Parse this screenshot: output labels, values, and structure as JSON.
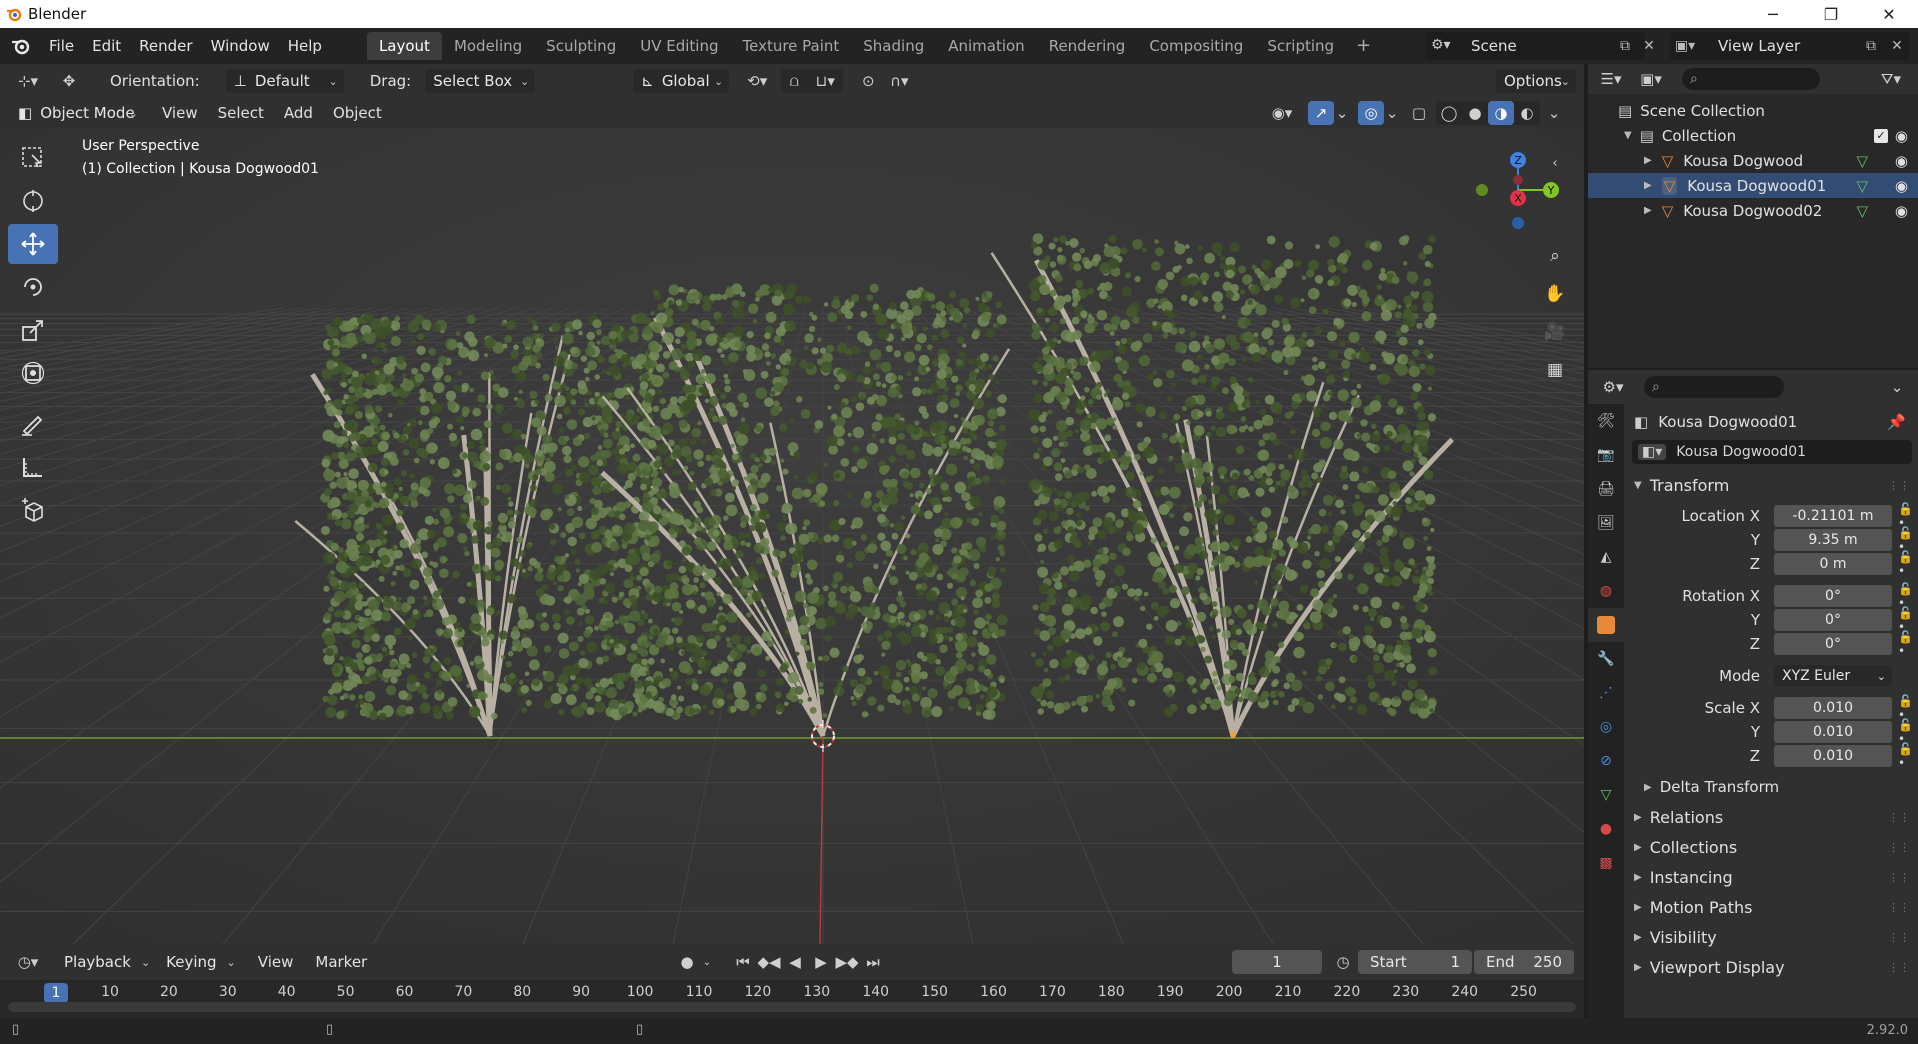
{
  "window": {
    "title": "Blender"
  },
  "menu": [
    "File",
    "Edit",
    "Render",
    "Window",
    "Help"
  ],
  "workspaces": {
    "tabs": [
      "Layout",
      "Modeling",
      "Sculpting",
      "UV Editing",
      "Texture Paint",
      "Shading",
      "Animation",
      "Rendering",
      "Compositing",
      "Scripting"
    ],
    "active_index": 0
  },
  "scene": {
    "name": "Scene"
  },
  "view_layer": {
    "name": "View Layer"
  },
  "viewport_header": {
    "orientation_label": "Orientation:",
    "orientation_value": "Default",
    "drag_label": "Drag:",
    "drag_value": "Select Box",
    "transform_orientation": "Global",
    "options_label": "Options",
    "mode": "Object Mode",
    "menus": [
      "View",
      "Select",
      "Add",
      "Object"
    ]
  },
  "viewport": {
    "perspective": "User Perspective",
    "context": "(1) Collection | Kousa Dogwood01",
    "gizmo_axes": [
      "Z",
      "Y",
      "X"
    ]
  },
  "outliner": {
    "scene_collection": "Scene Collection",
    "collection": "Collection",
    "objects": [
      "Kousa Dogwood",
      "Kousa Dogwood01",
      "Kousa Dogwood02"
    ]
  },
  "properties": {
    "object_name": "Kousa Dogwood01",
    "datablock_name": "Kousa Dogwood01",
    "transform_title": "Transform",
    "location": {
      "label": "Location X",
      "x": "-0.21101 m",
      "y": "9.35 m",
      "z": "0 m"
    },
    "rotation": {
      "label": "Rotation X",
      "x": "0°",
      "y": "0°",
      "z": "0°"
    },
    "mode_label": "Mode",
    "mode_value": "XYZ Euler",
    "scale": {
      "label": "Scale X",
      "x": "0.010",
      "y": "0.010",
      "z": "0.010"
    },
    "axis_y": "Y",
    "axis_z": "Z",
    "delta_transform": "Delta Transform",
    "sections": [
      "Relations",
      "Collections",
      "Instancing",
      "Motion Paths",
      "Visibility",
      "Viewport Display"
    ]
  },
  "timeline": {
    "menus": [
      "Playback",
      "Keying",
      "View",
      "Marker"
    ],
    "current_frame": "1",
    "start_label": "Start",
    "start_value": "1",
    "end_label": "End",
    "end_value": "250",
    "ruler_ticks": [
      "10",
      "20",
      "30",
      "40",
      "50",
      "60",
      "70",
      "80",
      "90",
      "100",
      "110",
      "120",
      "130",
      "140",
      "150",
      "160",
      "170",
      "180",
      "190",
      "200",
      "210",
      "220",
      "230",
      "240",
      "250"
    ],
    "ruler_current": "1"
  },
  "status": {
    "version": "2.92.0"
  },
  "colors": {
    "accent": "#4772b3",
    "x_axis": "#e0334a",
    "y_axis": "#82c424",
    "z_axis": "#3e83e0",
    "foliage": "#5d7443"
  }
}
